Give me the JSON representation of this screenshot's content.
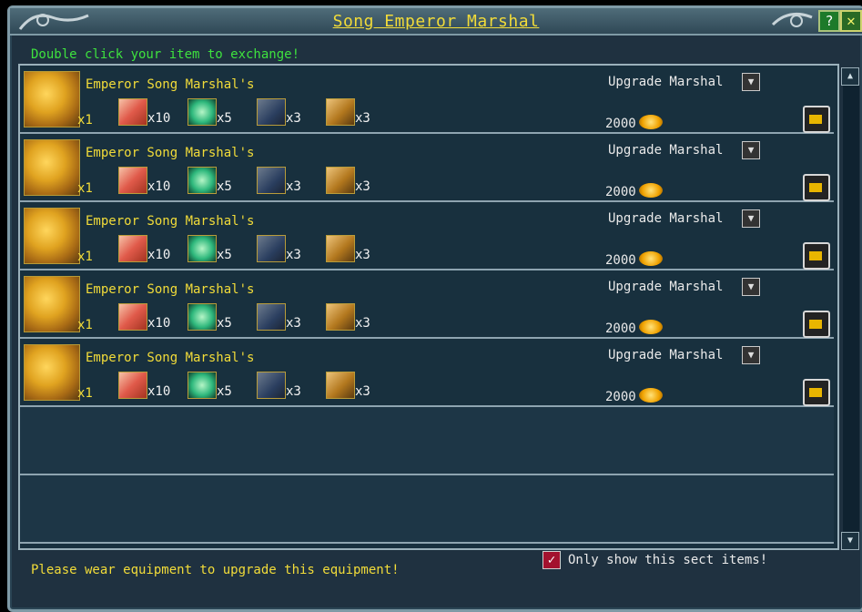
{
  "window": {
    "title": "Song Emperor Marshal"
  },
  "instructions": "Double click your item to exchange!",
  "rows": [
    {
      "name": "Emperor Song Marshal's",
      "main_qty": "x1",
      "materials": [
        "x10",
        "x5",
        "x3",
        "x3"
      ],
      "upgrade_label": "Upgrade Marshal",
      "price": "2000"
    },
    {
      "name": "Emperor Song Marshal's",
      "main_qty": "x1",
      "materials": [
        "x10",
        "x5",
        "x3",
        "x3"
      ],
      "upgrade_label": "Upgrade Marshal",
      "price": "2000"
    },
    {
      "name": "Emperor Song Marshal's",
      "main_qty": "x1",
      "materials": [
        "x10",
        "x5",
        "x3",
        "x3"
      ],
      "upgrade_label": "Upgrade Marshal",
      "price": "2000"
    },
    {
      "name": "Emperor Song Marshal's",
      "main_qty": "x1",
      "materials": [
        "x10",
        "x5",
        "x3",
        "x3"
      ],
      "upgrade_label": "Upgrade Marshal",
      "price": "2000"
    },
    {
      "name": "Emperor Song Marshal's",
      "main_qty": "x1",
      "materials": [
        "x10",
        "x5",
        "x3",
        "x3"
      ],
      "upgrade_label": "Upgrade Marshal",
      "price": "2000"
    }
  ],
  "footer": {
    "message": "Please wear equipment to upgrade this equipment!",
    "checkbox_label": "Only show this sect items!"
  },
  "colors": {
    "accent": "#f2dc39",
    "instruction": "#3ee23e",
    "panel": "#1f3140"
  }
}
